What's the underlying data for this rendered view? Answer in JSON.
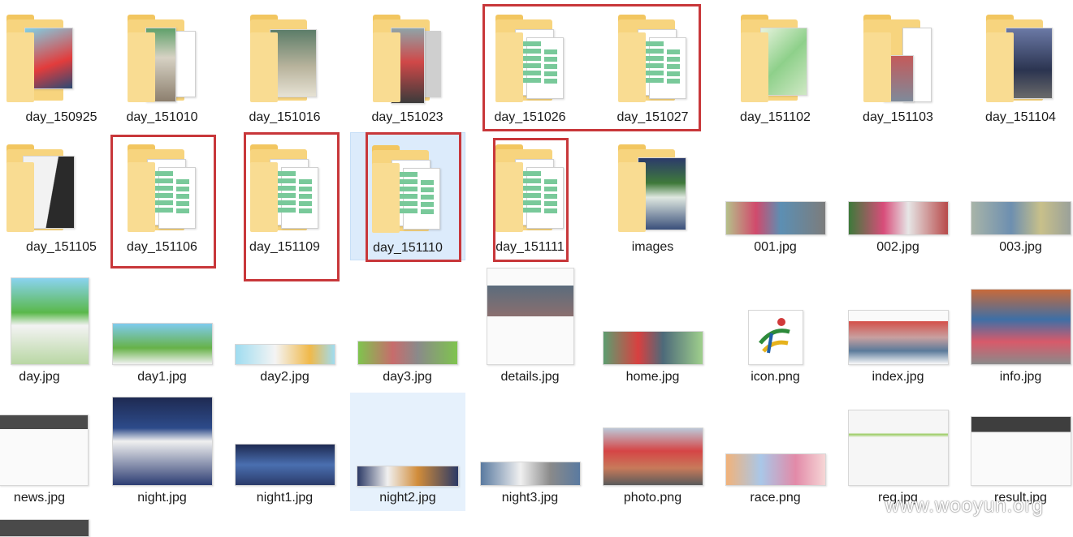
{
  "explorer": {
    "items": [
      {
        "name": "day_150925",
        "type": "folder"
      },
      {
        "name": "day_151010",
        "type": "folder"
      },
      {
        "name": "day_151016",
        "type": "folder"
      },
      {
        "name": "day_151023",
        "type": "folder"
      },
      {
        "name": "day_151026",
        "type": "folder-excel"
      },
      {
        "name": "day_151027",
        "type": "folder-excel"
      },
      {
        "name": "day_151102",
        "type": "folder"
      },
      {
        "name": "day_151103",
        "type": "folder"
      },
      {
        "name": "day_151104",
        "type": "folder"
      },
      {
        "name": "day_151105",
        "type": "folder"
      },
      {
        "name": "day_151106",
        "type": "folder-excel"
      },
      {
        "name": "day_151109",
        "type": "folder-excel"
      },
      {
        "name": "day_151110",
        "type": "folder-excel",
        "selected": true
      },
      {
        "name": "day_151111",
        "type": "folder-excel"
      },
      {
        "name": "images",
        "type": "folder"
      },
      {
        "name": "001.jpg",
        "type": "image"
      },
      {
        "name": "002.jpg",
        "type": "image"
      },
      {
        "name": "003.jpg",
        "type": "image"
      },
      {
        "name": "day.jpg",
        "type": "image"
      },
      {
        "name": "day1.jpg",
        "type": "image"
      },
      {
        "name": "day2.jpg",
        "type": "image"
      },
      {
        "name": "day3.jpg",
        "type": "image"
      },
      {
        "name": "details.jpg",
        "type": "image"
      },
      {
        "name": "home.jpg",
        "type": "image"
      },
      {
        "name": "icon.png",
        "type": "image"
      },
      {
        "name": "index.jpg",
        "type": "image"
      },
      {
        "name": "info.jpg",
        "type": "image"
      },
      {
        "name": "news.jpg",
        "type": "image"
      },
      {
        "name": "night.jpg",
        "type": "image"
      },
      {
        "name": "night1.jpg",
        "type": "image"
      },
      {
        "name": "night2.jpg",
        "type": "image",
        "selected": true
      },
      {
        "name": "night3.jpg",
        "type": "image"
      },
      {
        "name": "photo.png",
        "type": "image"
      },
      {
        "name": "race.png",
        "type": "image"
      },
      {
        "name": "reg.jpg",
        "type": "image"
      },
      {
        "name": "result.jpg",
        "type": "image"
      }
    ]
  },
  "watermark": "www.wooyun.org",
  "colors": {
    "folder": "#f7d47e",
    "highlight": "#c8373a",
    "selection": "#dcebfb",
    "excel_green": "#79c99a"
  }
}
